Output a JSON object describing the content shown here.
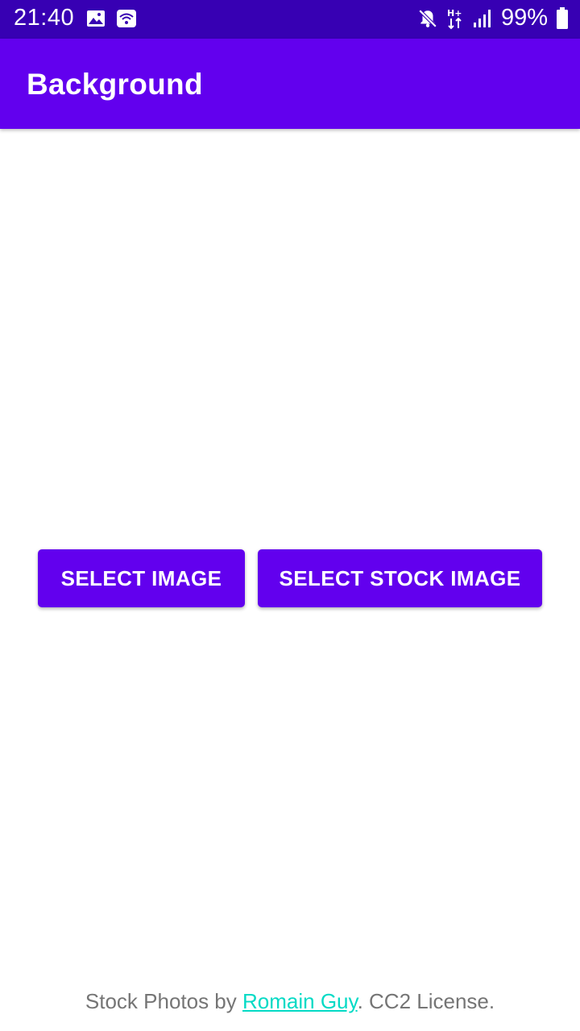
{
  "status_bar": {
    "time": "21:40",
    "battery": "99%",
    "icons": [
      "image-icon",
      "wifi-icon",
      "mute-icon",
      "hplus-data-icon",
      "signal-icon",
      "battery-icon"
    ],
    "background": "#3700B3"
  },
  "app_bar": {
    "title": "Background",
    "background": "#6200EE"
  },
  "actions": {
    "select_image_label": "SELECT IMAGE",
    "select_stock_image_label": "SELECT STOCK IMAGE"
  },
  "footer": {
    "prefix": "Stock Photos by ",
    "link_text": "Romain Guy",
    "suffix": ". CC2 License.",
    "link_color": "#03DAC5"
  }
}
